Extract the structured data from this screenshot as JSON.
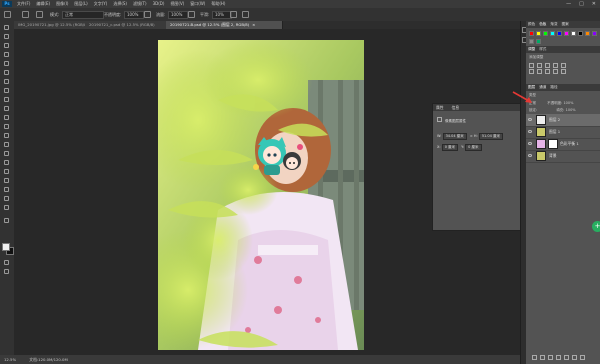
{
  "app": {
    "logo": "Ps"
  },
  "menu": {
    "items": [
      "文件(F)",
      "编辑(E)",
      "图像(I)",
      "图层(L)",
      "文字(Y)",
      "选择(S)",
      "滤镜(T)",
      "3D(D)",
      "视图(V)",
      "窗口(W)",
      "帮助(H)"
    ]
  },
  "window_controls": {
    "minimize": "—",
    "maximize": "□",
    "close": "✕"
  },
  "options": {
    "mode_label": "模式:",
    "mode_value": "正常",
    "opacity_label": "不透明度:",
    "opacity_value": "100%",
    "flow_label": "流量:",
    "flow_value": "100%",
    "smooth_label": "平滑:",
    "smooth_value": "10%"
  },
  "tabs": [
    {
      "label": "IMG_20190721.jpg @ 12.5% (RGB/8)"
    },
    {
      "label": "20190721_c.psd @ 12.5% (RGB/8)"
    },
    {
      "label": "20190721-B.psd @ 12.5% (图层 2, RGB/8)",
      "active": true
    }
  ],
  "status": {
    "zoom": "12.5%",
    "doc": "文档:120.0M/120.0M"
  },
  "properties": {
    "tabs": [
      "属性",
      "信息"
    ],
    "title": "像素图层属性",
    "w_label": "W:",
    "w_value": "34.04 厘米",
    "h_label": "H:",
    "h_value": "51.04 厘米",
    "x_label": "X:",
    "x_value": "0 厘米",
    "y_label": "Y:",
    "y_value": "0 厘米",
    "link": "∞"
  },
  "right": {
    "top_tabs": [
      "颜色",
      "色板",
      "渐变",
      "图案"
    ],
    "adjust_tabs": [
      "调整",
      "样式"
    ],
    "adjust_title": "添加调整",
    "layer_tabs": [
      "图层",
      "通道",
      "路径"
    ],
    "kind_label": "类型",
    "blend_mode": "正常",
    "opacity_label": "不透明度:",
    "opacity_value": "100%",
    "lock_label": "锁定:",
    "fill_label": "填充:",
    "fill_value": "100%",
    "layers": [
      {
        "name": "图层 2"
      },
      {
        "name": "图层 1"
      },
      {
        "name": "色彩平衡 1"
      },
      {
        "name": "背景"
      }
    ]
  },
  "colors": {
    "accent": "#27ae60",
    "swatches": [
      "#ff0000",
      "#ffff00",
      "#00ff00",
      "#00ffff",
      "#0000ff",
      "#ff00ff",
      "#ffffff",
      "#000000",
      "#ff8800",
      "#8800ff",
      "#888888",
      "#00aa66"
    ]
  }
}
